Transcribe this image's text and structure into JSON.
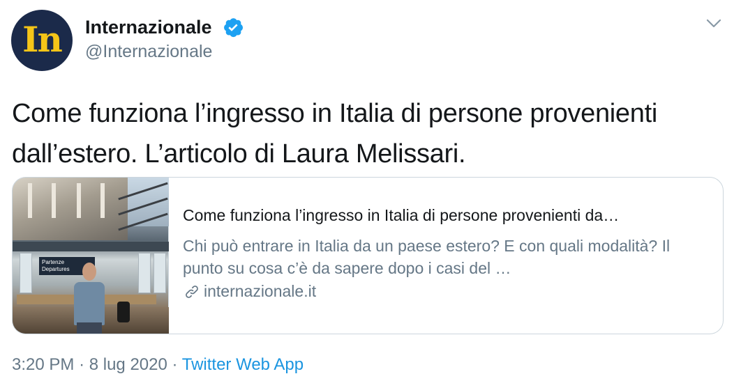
{
  "tweet": {
    "author": {
      "name": "Internazionale",
      "handle": "@Internazionale",
      "avatar_text": "In",
      "verified": true
    },
    "text": "Come funziona l’ingresso in Italia di persone provenienti dall’estero. L’articolo di Laura Melissari.",
    "card": {
      "title": "Come funziona l’ingresso in Italia di persone provenienti da…",
      "description": "Chi può entrare in Italia da un paese estero? E con quali modalità? Il punto su cosa c’è da sapere dopo i casi del …",
      "domain": "internazionale.it",
      "image_sign_text": "Partenze Departures"
    },
    "footer": {
      "time": "3:20 PM",
      "separator": "·",
      "date": "8 lug 2020",
      "source": "Twitter Web App"
    }
  },
  "colors": {
    "text_primary": "#14171a",
    "text_secondary": "#657786",
    "link_blue": "#1b95e0",
    "verified_blue": "#1da1f2",
    "avatar_bg": "#1b2a4a",
    "avatar_fg": "#f5c518",
    "border": "#ccd6dd"
  },
  "icons": [
    "verified-badge-icon",
    "chevron-down-icon",
    "link-icon"
  ]
}
